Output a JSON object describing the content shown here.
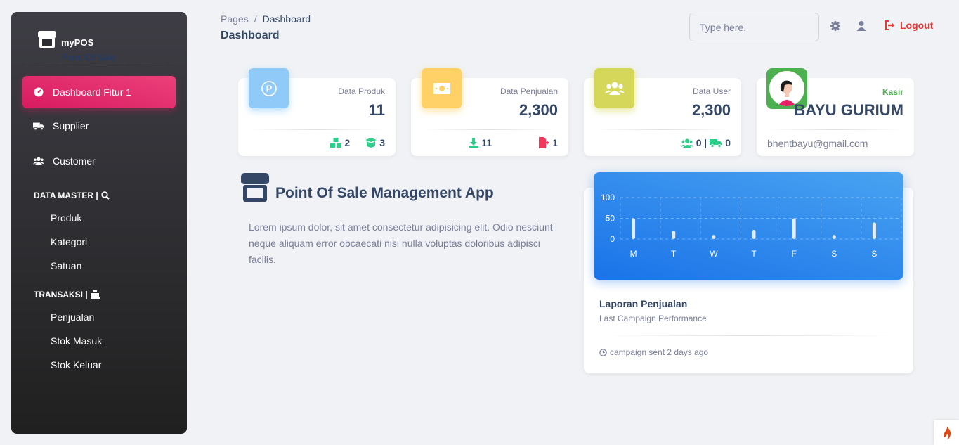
{
  "sidebar": {
    "brand_name": "myPOS",
    "brand_sub": "Point Of Sale",
    "items": [
      {
        "label": "Dashboard Fitur 1",
        "icon": "gauge-icon",
        "active": true
      },
      {
        "label": "Supplier",
        "icon": "truck-icon"
      },
      {
        "label": "Customer",
        "icon": "users-icon"
      }
    ],
    "section_master": "DATA MASTER |",
    "master_items": [
      "Produk",
      "Kategori",
      "Satuan"
    ],
    "section_transaksi": "TRANSAKSI |",
    "transaksi_items": [
      "Penjualan",
      "Stok Masuk",
      "Stok Keluar"
    ]
  },
  "header": {
    "breadcrumb_root": "Pages",
    "breadcrumb_sep": "/",
    "breadcrumb_current": "Dashboard",
    "title": "Dashboard",
    "search_placeholder": "Type here.",
    "logout_label": "Logout"
  },
  "stats": [
    {
      "label": "Data Produk",
      "value": "11",
      "badge_color": "#90caf9",
      "foot_a": "2",
      "foot_b": "3"
    },
    {
      "label": "Data Penjualan",
      "value": "2,300",
      "badge_color": "#ffd166",
      "foot_a": "11",
      "foot_b": "1"
    },
    {
      "label": "Data User",
      "value": "2,300",
      "badge_color": "#d4d75a",
      "foot_a": "0",
      "foot_sep": "|",
      "foot_b": "0"
    }
  ],
  "profile": {
    "role": "Kasir",
    "name": "BAYU GURIUM",
    "email": "bhentbayu@gmail.com"
  },
  "intro": {
    "title": "Point Of Sale Management App",
    "text": "Lorem ipsum dolor, sit amet consectetur adipisicing elit. Odio nesciunt neque aliquam error obcaecati nisi nulla voluptas doloribus adipisci facilis."
  },
  "chart_data": {
    "type": "bar",
    "categories": [
      "M",
      "T",
      "W",
      "T",
      "F",
      "S",
      "S"
    ],
    "values": [
      50,
      20,
      10,
      22,
      50,
      10,
      40
    ],
    "ylim": [
      0,
      100
    ],
    "yticks": [
      "100",
      "50",
      "0"
    ],
    "grid": true,
    "title": "Laporan Penjualan",
    "subtitle": "Last Campaign Performance",
    "footer": "campaign sent 2 days ago"
  },
  "colors": {
    "accent": "#e91e63",
    "danger": "#e53935",
    "success": "#4caf50",
    "teal": "#2dce89"
  }
}
